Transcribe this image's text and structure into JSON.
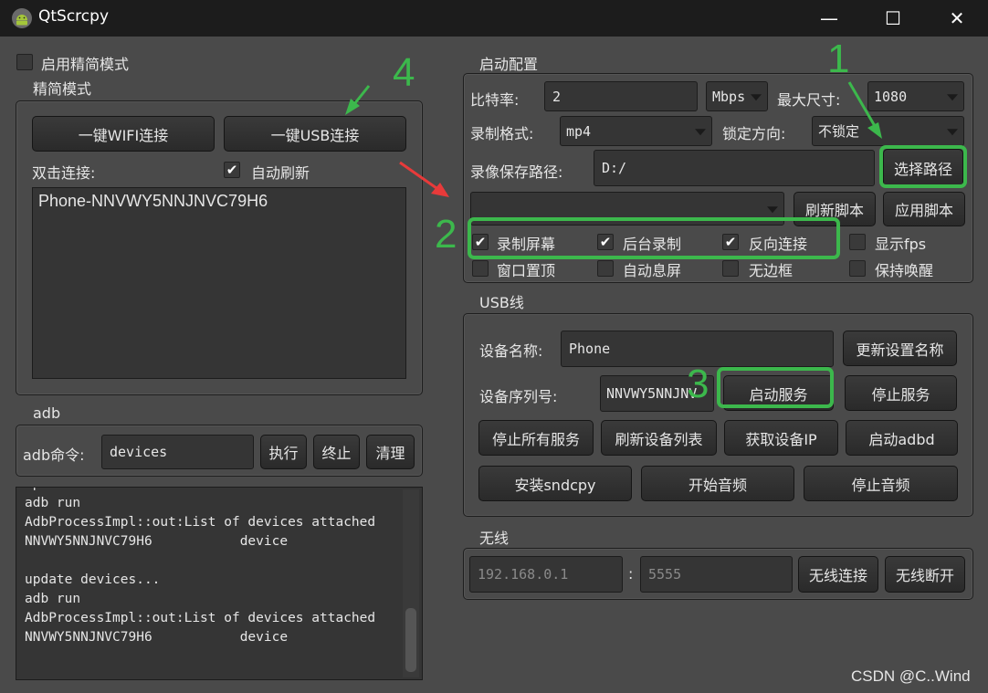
{
  "window": {
    "title": "QtScrcpy",
    "minimize": "—",
    "maximize": "☐",
    "close": "✕"
  },
  "left": {
    "simple_mode_toggle": "启用精简模式",
    "simple_group_title": "精简模式",
    "wifi_connect_btn": "一键WIFI连接",
    "usb_connect_btn": "一键USB连接",
    "double_click_label": "双击连接:",
    "auto_refresh_label": "自动刷新",
    "devices": [
      "Phone-NNVWY5NNJNVC79H6"
    ],
    "adb_group_title": "adb",
    "adb_cmd_label": "adb命令:",
    "adb_cmd_value": "devices",
    "exec_btn": "执行",
    "stop_btn": "终止",
    "clear_btn": "清理",
    "log_lines": [
      "update devices...",
      "adb run",
      "AdbProcessImpl::out:List of devices attached",
      "NNVWY5NNJNVC79H6           device",
      "",
      "update devices...",
      "adb run",
      "AdbProcessImpl::out:List of devices attached",
      "NNVWY5NNJNVC79H6           device"
    ]
  },
  "launch": {
    "group_title": "启动配置",
    "bitrate_label": "比特率:",
    "bitrate_value": "2",
    "bitrate_unit": "Mbps",
    "max_size_label": "最大尺寸:",
    "max_size_value": "1080",
    "record_format_label": "录制格式:",
    "record_format_value": "mp4",
    "lock_orientation_label": "锁定方向:",
    "lock_orientation_value": "不锁定",
    "save_path_label": "录像保存路径:",
    "save_path_value": "D:/",
    "choose_path_btn": "选择路径",
    "script_value": "",
    "refresh_script_btn": "刷新脚本",
    "apply_script_btn": "应用脚本",
    "options": [
      {
        "label": "录制屏幕",
        "checked": true
      },
      {
        "label": "后台录制",
        "checked": true
      },
      {
        "label": "反向连接",
        "checked": true
      },
      {
        "label": "显示fps",
        "checked": false
      },
      {
        "label": "窗口置顶",
        "checked": false
      },
      {
        "label": "自动息屏",
        "checked": false
      },
      {
        "label": "无边框",
        "checked": false
      },
      {
        "label": "保持唤醒",
        "checked": false
      }
    ]
  },
  "usb": {
    "group_title": "USB线",
    "device_name_label": "设备名称:",
    "device_name_value": "Phone",
    "update_name_btn": "更新设置名称",
    "serial_label": "设备序列号:",
    "serial_value": "NNVWY5NNJNV",
    "start_service_btn": "启动服务",
    "stop_service_btn": "停止服务",
    "stop_all_btn": "停止所有服务",
    "refresh_list_btn": "刷新设备列表",
    "get_ip_btn": "获取设备IP",
    "start_adbd_btn": "启动adbd",
    "install_sndcpy_btn": "安装sndcpy",
    "start_audio_btn": "开始音频",
    "stop_audio_btn": "停止音频"
  },
  "wireless": {
    "group_title": "无线",
    "ip_placeholder": "192.168.0.1",
    "colon": ":",
    "port_placeholder": "5555",
    "connect_btn": "无线连接",
    "disconnect_btn": "无线断开"
  },
  "annotations": {
    "n1": "1",
    "n2": "2",
    "n3": "3",
    "n4": "4",
    "color": "#3cb84c",
    "arrow_color": "#e83a3a"
  },
  "watermark": "CSDN @C..Wind"
}
